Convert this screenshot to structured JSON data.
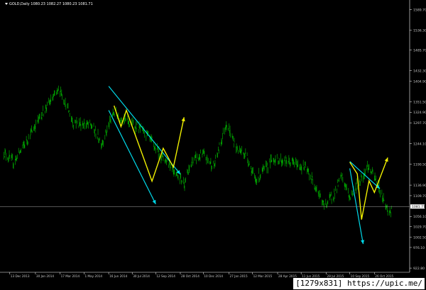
{
  "header": {
    "symbol_label": "GOLD,Daily",
    "ohlc": "1080.23 1082.27 1080.23 1081.71"
  },
  "watermark": {
    "text": "[1279x831] https://upic.me/"
  },
  "price_axis": {
    "labels": [
      "1589.70",
      "1536.30",
      "1485.70",
      "1432.30",
      "1404.90",
      "1351.50",
      "1324.90",
      "1297.70",
      "1244.10",
      "1190.50",
      "1136.90",
      "1109.70",
      "1056.10",
      "1029.70",
      "1002.50",
      "976.10",
      "922.80"
    ]
  },
  "current_price": {
    "label": "1081.71",
    "value": 1081.71,
    "line_color": "#a8a8a8",
    "tag_color": "#ffffff"
  },
  "time_axis": {
    "labels": [
      "13 Dec 2013",
      "30 Jan 2014",
      "17 Mar 2014",
      "1 May 2014",
      "16 Jun 2014",
      "30 Jul 2014",
      "12 Sep 2014",
      "28 Oct 2014",
      "10 Dec 2014",
      "27 Jan 2015",
      "12 Mar 2015",
      "28 Apr 2015",
      "11 Jun 2015",
      "28 Jul 2015",
      "10 Sep 2015",
      "26 Oct 2015"
    ]
  },
  "colors": {
    "background": "#000000",
    "candles": "#00c000",
    "trend_lines": "#00d8e8",
    "wave_lines": "#f0f000",
    "axis_text": "#c8c8c8"
  },
  "drawings": {
    "trend_arrows": [
      {
        "from": [
          "16 Jun 2014",
          1392
        ],
        "to": [
          "28 Oct 2014",
          1165
        ]
      },
      {
        "from": [
          "16 Jun 2014",
          1330
        ],
        "to": [
          "12 Sep 2014",
          1088
        ]
      },
      {
        "from": [
          "10 Sep 2015",
          1198
        ],
        "to": [
          "5 Nov 2015",
          1128
        ]
      },
      {
        "from": [
          "10 Sep 2015",
          1180
        ],
        "to": [
          "5 Oct 2015",
          985
        ]
      }
    ],
    "wave_paths": [
      {
        "points": [
          [
            "26 Jun 2014",
            1342
          ],
          [
            "9 Jul 2014",
            1288
          ],
          [
            "19 Jul 2014",
            1330
          ],
          [
            "5 Sep 2014",
            1147
          ],
          [
            "26 Sep 2014",
            1232
          ],
          [
            "15 Oct 2014",
            1183
          ],
          [
            "4 Nov 2014",
            1312
          ]
        ]
      },
      {
        "points": [
          [
            "10 Sep 2015",
            1196
          ],
          [
            "24 Sep 2015",
            1166
          ],
          [
            "2 Oct 2015",
            1048
          ],
          [
            "16 Oct 2015",
            1148
          ],
          [
            "26 Oct 2015",
            1118
          ],
          [
            "20 Nov 2015",
            1208
          ]
        ]
      }
    ]
  }
}
